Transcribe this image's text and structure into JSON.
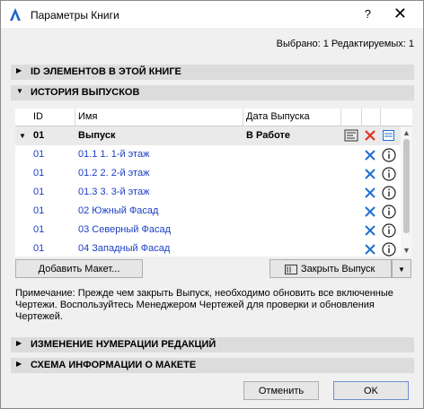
{
  "window": {
    "title": "Параметры Книги",
    "help_label": "?",
    "close_label": "✕"
  },
  "selection_info": "Выбрано: 1 Редактируемых: 1",
  "sections": {
    "ids": "ID ЭЛЕМЕНТОВ В ЭТОЙ КНИГЕ",
    "history": "ИСТОРИЯ ВЫПУСКОВ",
    "renumbering": "ИЗМЕНЕНИЕ НУМЕРАЦИИ РЕДАКЦИЙ",
    "layout_info": "СХЕМА ИНФОРМАЦИИ О МАКЕТЕ"
  },
  "table": {
    "headers": {
      "id": "ID",
      "name": "Имя",
      "date": "Дата Выпуска"
    },
    "group": {
      "id": "01",
      "name": "Выпуск",
      "date": "В Работе"
    },
    "rows": [
      {
        "id": "01",
        "name": "01.1 1. 1-й этаж"
      },
      {
        "id": "01",
        "name": "01.2 2. 2-й этаж"
      },
      {
        "id": "01",
        "name": "01.3 3. 3-й этаж"
      },
      {
        "id": "01",
        "name": "02 Южный Фасад"
      },
      {
        "id": "01",
        "name": "03 Северный Фасад"
      },
      {
        "id": "01",
        "name": "04 Западный Фасад"
      }
    ]
  },
  "buttons": {
    "add_layout": "Добавить Макет...",
    "close_issue": "Закрыть Выпуск",
    "cancel": "Отменить",
    "ok": "OK"
  },
  "note": "Примечание: Прежде чем закрыть Выпуск, необходимо обновить все включенные Чертежи. Воспользуйтесь Менеджером Чертежей для проверки и обновления Чертежей.",
  "colors": {
    "link_blue": "#1a3fc4",
    "x_blue": "#1f6fd1",
    "x_red": "#e03020",
    "section_bg": "#dcdcdc"
  }
}
